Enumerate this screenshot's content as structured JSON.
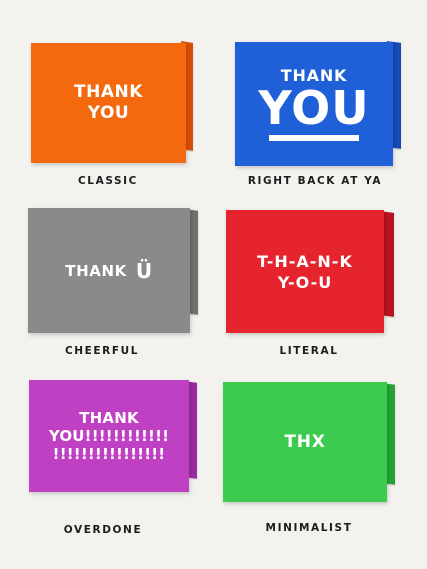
{
  "cards": [
    {
      "caption": "CLASSIC",
      "lines": [
        "THANK",
        "YOU"
      ],
      "color": "#f4680e",
      "back_color": "#d84f07"
    },
    {
      "caption": "RIGHT BACK AT YA",
      "lines": [
        "THANK",
        "YOU"
      ],
      "color": "#1f5fd8",
      "back_color": "#164bb6"
    },
    {
      "caption": "CHEERFUL",
      "lines": [
        "THANK",
        "Ü"
      ],
      "color": "#8a8a8a",
      "back_color": "#6f6f6f"
    },
    {
      "caption": "LITERAL",
      "lines": [
        "T-H-A-N-K",
        "Y-O-U"
      ],
      "color": "#e5242e",
      "back_color": "#b9141f"
    },
    {
      "caption": "OVERDONE",
      "lines": [
        "THANK",
        "YOU!!!!!!!!!!!!",
        "!!!!!!!!!!!!!!!!"
      ],
      "color": "#c040c4",
      "back_color": "#9a2ca2"
    },
    {
      "caption": "MINIMALIST",
      "lines": [
        "THX"
      ],
      "color": "#3ccb4e",
      "back_color": "#25a336"
    }
  ]
}
